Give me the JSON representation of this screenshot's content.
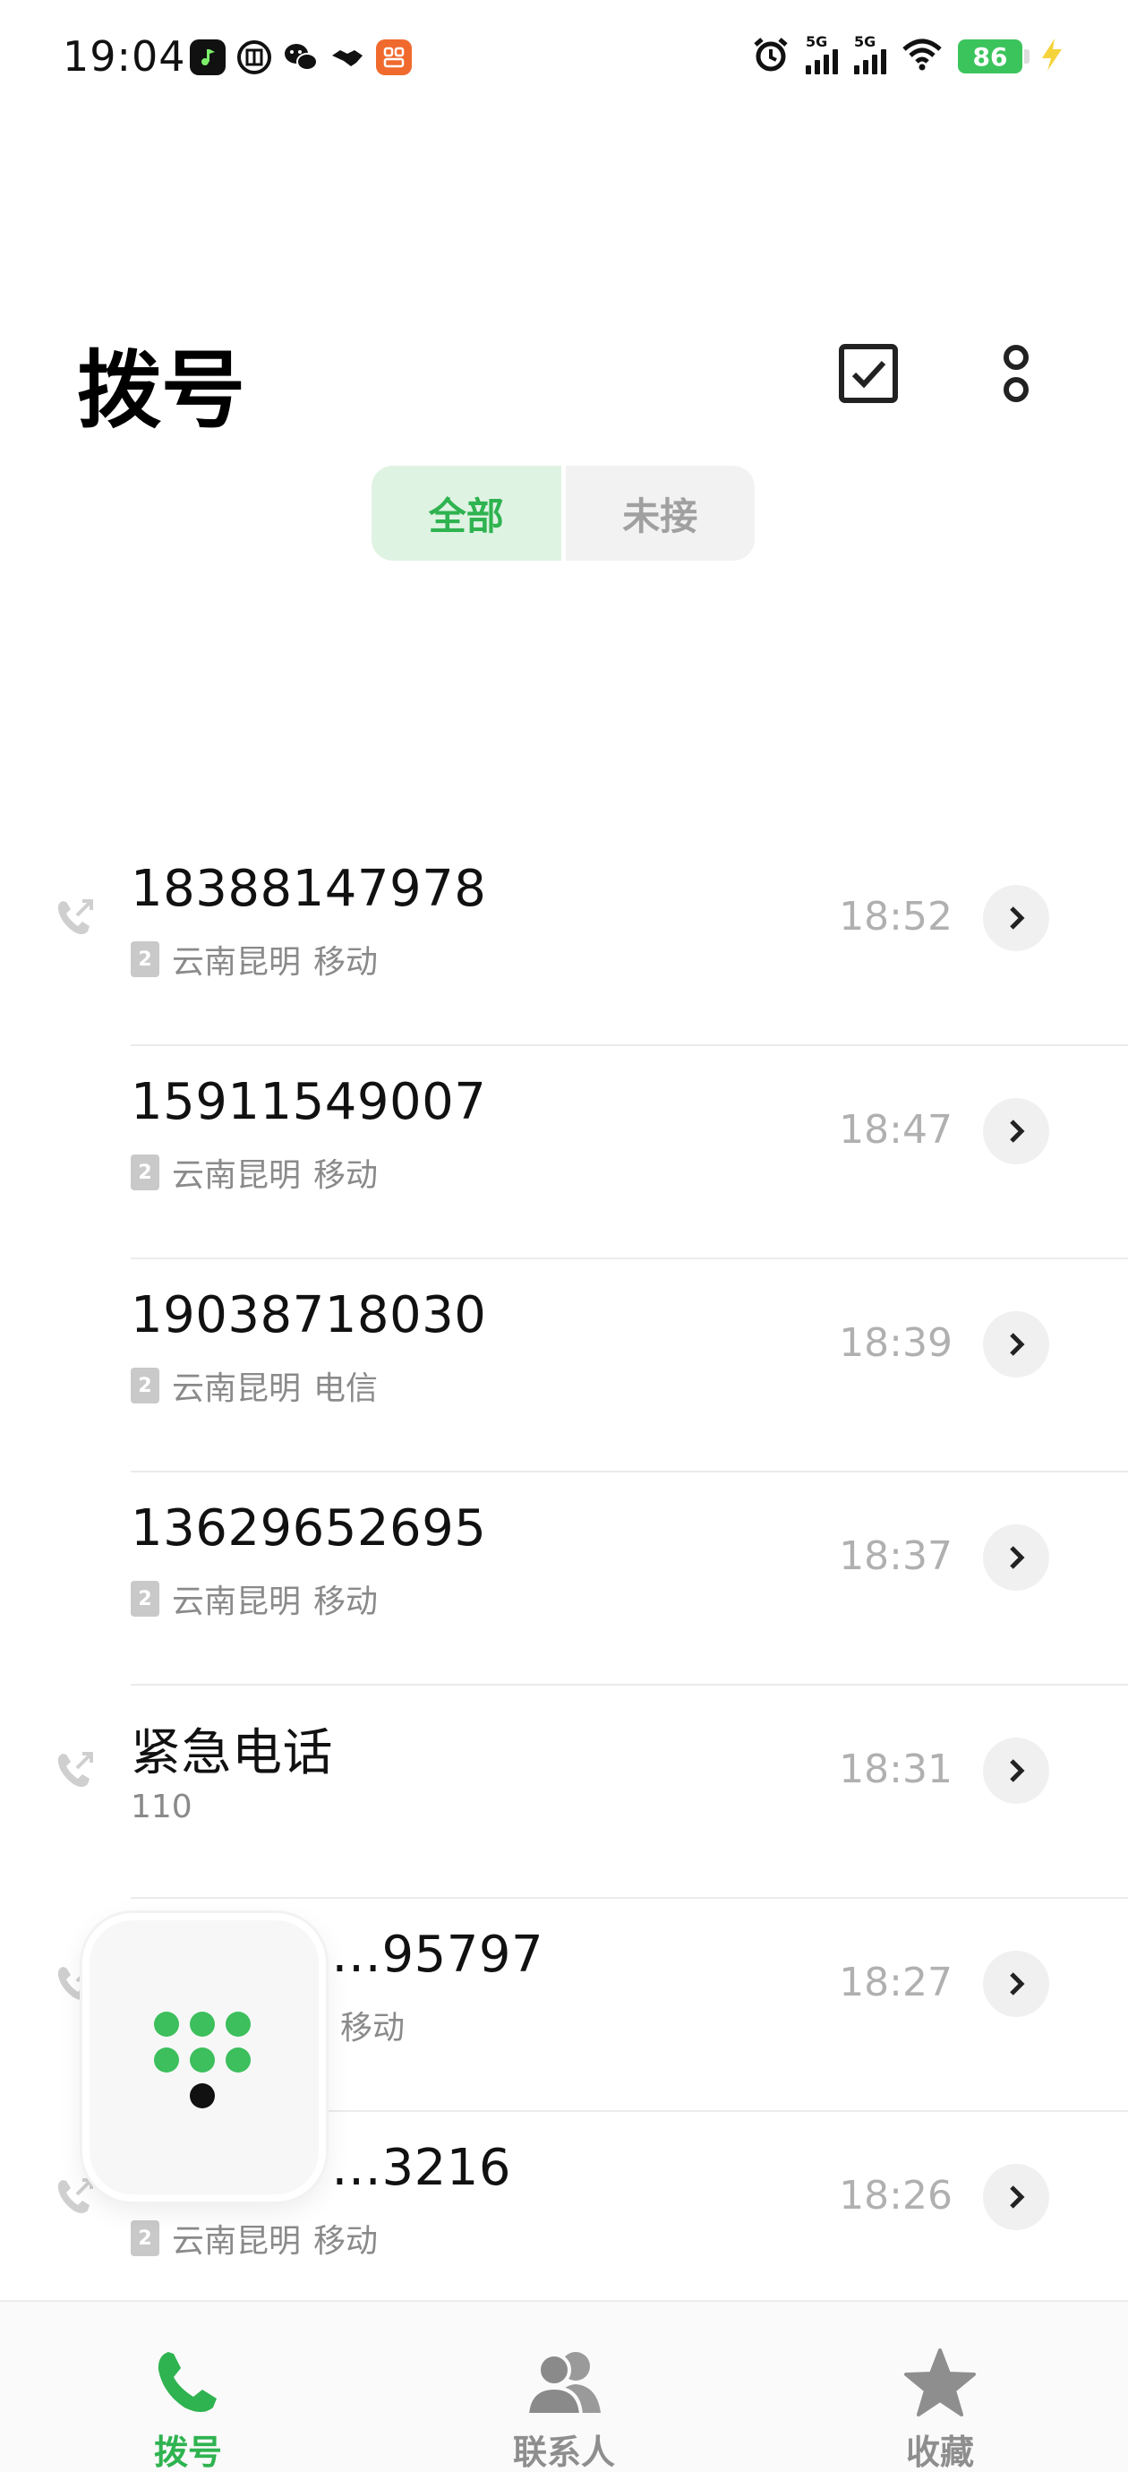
{
  "status_bar": {
    "time": "19:04",
    "battery": "86",
    "signal_1": "5G",
    "signal_2": "5G"
  },
  "header": {
    "title": "拨号"
  },
  "tabs": [
    {
      "label": "全部",
      "active": true
    },
    {
      "label": "未接",
      "active": false
    }
  ],
  "calls": [
    {
      "name": "18388147978",
      "sim": "2",
      "location": "云南昆明",
      "carrier": "移动",
      "time": "18:52",
      "icon": "outgoing-call-icon"
    },
    {
      "name": "15911549007",
      "sim": "2",
      "location": "云南昆明",
      "carrier": "移动",
      "time": "18:47",
      "icon": ""
    },
    {
      "name": "19038718030",
      "sim": "2",
      "location": "云南昆明",
      "carrier": "电信",
      "time": "18:39",
      "icon": ""
    },
    {
      "name": "13629652695",
      "sim": "2",
      "location": "云南昆明",
      "carrier": "移动",
      "time": "18:37",
      "icon": ""
    },
    {
      "name": "紧急电话",
      "sub": "110",
      "time": "18:31",
      "icon": "outgoing-call-icon"
    },
    {
      "name": "…95797",
      "carrier": "移动",
      "time": "18:27",
      "icon": "outgoing-call-icon"
    },
    {
      "name": "…3216",
      "sim": "2",
      "location": "云南昆明",
      "carrier": "移动",
      "time": "18:26",
      "icon": "outgoing-call-icon"
    }
  ],
  "bottom_nav": [
    {
      "label": "拨号",
      "icon": "phone-icon",
      "active": true
    },
    {
      "label": "联系人",
      "icon": "contacts-icon",
      "active": false
    },
    {
      "label": "收藏",
      "icon": "star-icon",
      "active": false
    }
  ],
  "colors": {
    "accent": "#2fb350",
    "tab_active_bg": "#dff3e3",
    "muted": "#8a8a8a"
  }
}
